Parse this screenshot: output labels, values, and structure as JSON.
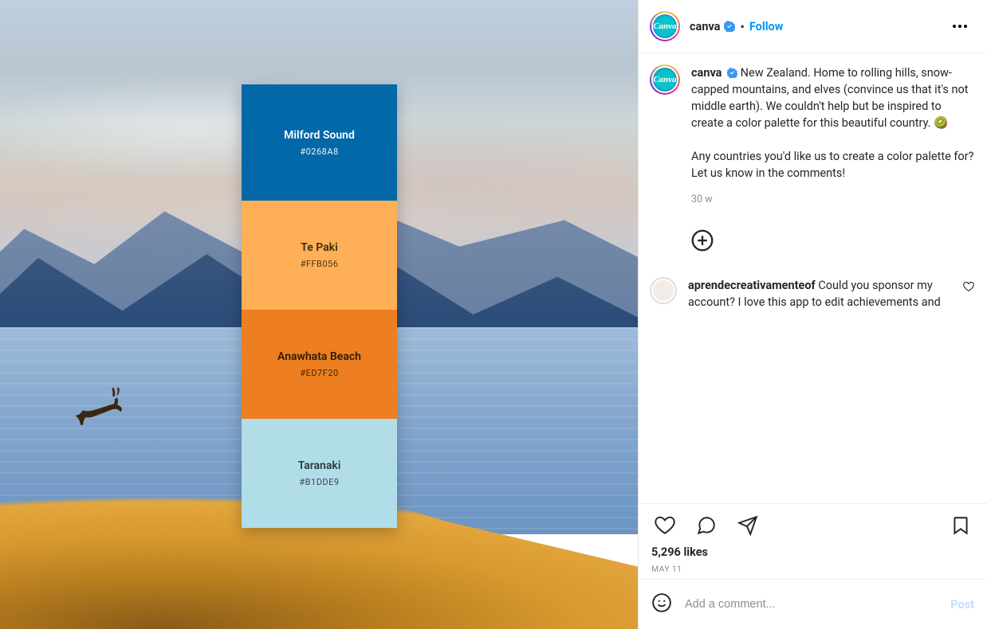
{
  "palette": [
    {
      "name": "Milford Sound",
      "hex": "#0268A8"
    },
    {
      "name": "Te Paki",
      "hex": "#FFB056"
    },
    {
      "name": "Anawhata Beach",
      "hex": "#ED7F20"
    },
    {
      "name": "Taranaki",
      "hex": "#B1DDE9"
    }
  ],
  "header": {
    "username": "canva",
    "avatar_text": "Canva",
    "separator": "•",
    "follow_label": "Follow"
  },
  "caption": {
    "username": "canva",
    "text_part1": "New Zealand. Home to rolling hills, snow-capped mountains, and elves (convince us that it's not middle earth). We couldn't help but be inspired to create a color palette for this beautiful country. 🥝",
    "text_part2": "Any countries you'd like us to create a color palette for? Let us know in the comments!",
    "age": "30 w"
  },
  "comments": [
    {
      "username": "aprendecreativamenteof",
      "text": "Could you sponsor my account? I love this app to edit achievements and"
    }
  ],
  "engagement": {
    "likes": "5,296 likes",
    "date": "MAY 11"
  },
  "add_comment": {
    "placeholder": "Add a comment...",
    "post_label": "Post"
  }
}
